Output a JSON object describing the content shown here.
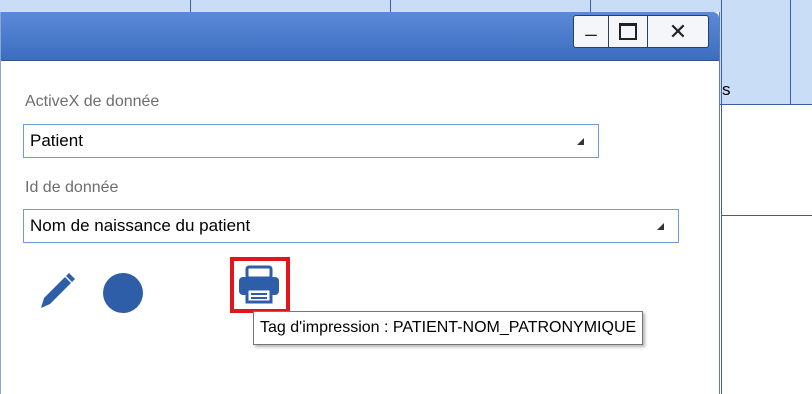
{
  "background": {
    "partial_text": "s"
  },
  "window_controls": {
    "minimize": "_",
    "maximize": "☐",
    "close": "✕"
  },
  "form": {
    "activex_label": "ActiveX de donnée",
    "activex_value": "Patient",
    "id_label": "Id de donnée",
    "id_value": "Nom de naissance du patient"
  },
  "icons": [
    "pencil-icon",
    "circle-icon",
    "printer-icon"
  ],
  "tooltip": {
    "text": "Tag d'impression : PATIENT-NOM_PATRONYMIQUE"
  },
  "colors": {
    "accent": "#2f5ea8",
    "titlebar": "#4a7bcd",
    "highlight": "#e3141b",
    "header_bg": "#c9ddf6"
  }
}
